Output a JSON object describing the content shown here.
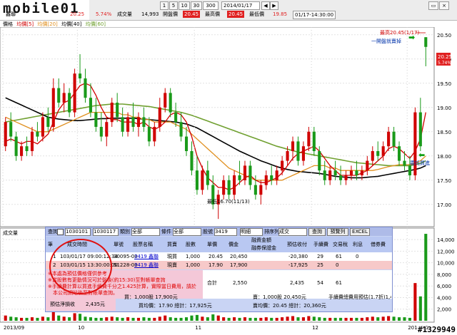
{
  "toolbar": {
    "logo": "mobile01",
    "stock_name": "鑫聯",
    "periods": [
      "1",
      "5",
      "10",
      "30"
    ],
    "period_value": "300",
    "date_value": "2014/01/17",
    "price_value": "20.25",
    "change_pct": "5.74%",
    "labels": {
      "volume": "成交量",
      "open": "開盤價",
      "high": "最高價",
      "low": "最低價"
    },
    "volume_value": "14,993",
    "open_value": "20.45",
    "high_value": "20.45",
    "low_value": "19.85",
    "time_range": "01/17-14:30:00"
  },
  "legend": {
    "price": "價格",
    "ma5": "均價[5]",
    "ma20": "均價[20]",
    "ma40": "均價[40]",
    "ma60": "均價[60]"
  },
  "chart": {
    "high_label": "最高20.45(1/17)",
    "low_label": "最低16.70(11/13)",
    "buy_tag": "一開盤就賣掉",
    "sell_tag": "委託買進",
    "last_price": "20.25",
    "last_pct": "5.74%",
    "volume_title": "成交量",
    "x_ticks": [
      "2013/09",
      "10",
      "11",
      "12",
      "2014/01"
    ],
    "price_ticks": [
      "20.50",
      "20.00",
      "19.50",
      "19.00",
      "18.50",
      "18.00",
      "17.50",
      "17.00"
    ],
    "volume_ticks": [
      "14,000",
      "12,000",
      "10,000",
      "8,000",
      "6,000",
      "4,000",
      "2,000"
    ],
    "watermark": "#1329949"
  },
  "chart_data": {
    "type": "candlestick",
    "title": "",
    "ylim": [
      16.6,
      20.6
    ],
    "ma5_color": "#d00000",
    "ma20_color": "#e09020",
    "ma40_color": "#000000",
    "ma60_color": "#70a030",
    "up_color": "#d00000",
    "down_color": "#1a9a1a",
    "candles": [
      [
        18.2,
        18.8,
        18.1,
        18.7
      ],
      [
        18.7,
        18.9,
        18.3,
        18.4
      ],
      [
        18.4,
        18.5,
        17.9,
        18.0
      ],
      [
        18.0,
        18.3,
        17.9,
        18.2
      ],
      [
        18.2,
        18.4,
        18.0,
        18.1
      ],
      [
        18.1,
        18.6,
        18.0,
        18.5
      ],
      [
        18.5,
        18.7,
        18.3,
        18.4
      ],
      [
        18.4,
        18.9,
        18.3,
        18.8
      ],
      [
        18.8,
        19.0,
        18.5,
        18.6
      ],
      [
        18.6,
        19.6,
        18.5,
        19.4
      ],
      [
        19.4,
        19.6,
        19.0,
        19.1
      ],
      [
        19.1,
        19.5,
        18.9,
        19.3
      ],
      [
        19.3,
        19.4,
        18.8,
        18.9
      ],
      [
        18.9,
        19.8,
        18.8,
        19.7
      ],
      [
        19.7,
        20.1,
        19.5,
        19.6
      ],
      [
        19.6,
        19.8,
        19.1,
        19.2
      ],
      [
        19.2,
        19.5,
        18.8,
        18.9
      ],
      [
        18.9,
        19.2,
        18.5,
        18.6
      ],
      [
        18.6,
        18.9,
        18.3,
        18.4
      ],
      [
        18.4,
        18.8,
        18.2,
        18.7
      ],
      [
        18.7,
        19.2,
        18.6,
        19.1
      ],
      [
        19.1,
        19.3,
        18.7,
        18.8
      ],
      [
        18.8,
        19.0,
        18.4,
        18.5
      ],
      [
        18.5,
        18.9,
        18.4,
        18.8
      ],
      [
        18.8,
        19.1,
        18.5,
        18.6
      ],
      [
        18.6,
        18.9,
        18.4,
        18.8
      ],
      [
        18.8,
        19.0,
        18.5,
        18.6
      ],
      [
        18.6,
        18.8,
        18.2,
        18.3
      ],
      [
        18.3,
        18.7,
        18.2,
        18.6
      ],
      [
        18.6,
        19.2,
        18.5,
        19.0
      ],
      [
        19.0,
        19.4,
        18.9,
        19.3
      ],
      [
        19.3,
        19.4,
        18.8,
        18.9
      ],
      [
        18.9,
        19.1,
        18.6,
        18.7
      ],
      [
        18.7,
        18.9,
        18.3,
        18.4
      ],
      [
        18.4,
        18.6,
        18.0,
        18.1
      ],
      [
        18.1,
        18.3,
        17.6,
        17.7
      ],
      [
        17.7,
        18.0,
        17.2,
        17.3
      ],
      [
        17.3,
        17.8,
        17.2,
        17.7
      ],
      [
        17.7,
        17.9,
        17.3,
        17.4
      ],
      [
        17.4,
        17.6,
        16.9,
        17.0
      ],
      [
        17.0,
        17.3,
        16.7,
        17.2
      ],
      [
        17.2,
        17.6,
        17.1,
        17.5
      ],
      [
        17.5,
        17.6,
        17.1,
        17.2
      ],
      [
        17.2,
        17.7,
        17.1,
        17.6
      ],
      [
        17.6,
        17.9,
        17.4,
        17.5
      ],
      [
        17.5,
        17.9,
        17.4,
        17.8
      ],
      [
        17.8,
        17.9,
        17.3,
        17.4
      ],
      [
        17.4,
        17.6,
        17.1,
        17.2
      ],
      [
        17.2,
        17.5,
        17.0,
        17.4
      ],
      [
        17.4,
        17.7,
        17.3,
        17.6
      ],
      [
        17.6,
        17.8,
        17.4,
        17.5
      ],
      [
        17.5,
        17.8,
        17.4,
        17.7
      ],
      [
        17.7,
        18.0,
        17.6,
        17.9
      ],
      [
        17.9,
        18.2,
        17.8,
        18.1
      ],
      [
        18.1,
        18.4,
        17.9,
        18.3
      ],
      [
        18.3,
        18.4,
        17.8,
        17.9
      ],
      [
        17.9,
        18.3,
        17.8,
        18.2
      ],
      [
        18.2,
        18.6,
        18.1,
        18.5
      ],
      [
        18.5,
        18.6,
        18.0,
        18.1
      ],
      [
        18.1,
        18.2,
        17.6,
        17.7
      ],
      [
        17.7,
        17.9,
        17.4,
        17.5
      ],
      [
        17.5,
        17.8,
        17.4,
        17.7
      ],
      [
        17.7,
        17.9,
        17.5,
        17.6
      ],
      [
        17.6,
        17.8,
        17.4,
        17.5
      ],
      [
        17.5,
        17.7,
        17.4,
        17.6
      ],
      [
        17.6,
        17.8,
        17.5,
        17.7
      ],
      [
        17.7,
        17.9,
        17.5,
        17.6
      ],
      [
        17.6,
        17.8,
        17.5,
        17.7
      ],
      [
        17.7,
        18.0,
        17.6,
        17.9
      ],
      [
        17.9,
        18.2,
        17.8,
        18.1
      ],
      [
        18.1,
        18.3,
        17.9,
        18.0
      ],
      [
        18.0,
        18.3,
        17.9,
        18.2
      ],
      [
        18.2,
        18.6,
        18.1,
        18.5
      ],
      [
        18.5,
        18.6,
        18.1,
        18.2
      ],
      [
        18.2,
        18.3,
        17.8,
        17.9
      ],
      [
        17.9,
        18.1,
        17.7,
        17.8
      ],
      [
        17.8,
        18.0,
        17.5,
        17.6
      ],
      [
        17.6,
        19.0,
        17.5,
        18.9
      ],
      [
        18.9,
        19.2,
        18.1,
        18.2
      ],
      [
        20.45,
        20.45,
        19.85,
        20.25
      ]
    ],
    "ma5": [
      18.3,
      18.35,
      18.3,
      18.25,
      18.3,
      18.3,
      18.25,
      18.35,
      18.45,
      18.7,
      18.95,
      19.1,
      19.15,
      19.3,
      19.45,
      19.5,
      19.45,
      19.25,
      19.0,
      18.8,
      18.75,
      18.75,
      18.7,
      18.7,
      18.7,
      18.65,
      18.7,
      18.6,
      18.55,
      18.6,
      18.7,
      18.85,
      18.9,
      18.85,
      18.7,
      18.4,
      18.0,
      17.75,
      17.55,
      17.45,
      17.35,
      17.35,
      17.3,
      17.35,
      17.45,
      17.55,
      17.6,
      17.5,
      17.45,
      17.45,
      17.5,
      17.55,
      17.65,
      17.8,
      17.95,
      18.05,
      18.1,
      18.15,
      18.2,
      18.1,
      17.95,
      17.8,
      17.7,
      17.6,
      17.6,
      17.6,
      17.6,
      17.65,
      17.7,
      17.8,
      17.9,
      18.0,
      18.15,
      18.2,
      18.15,
      18.05,
      17.95,
      18.1,
      18.35,
      18.9
    ],
    "ma20": [
      18.8,
      18.75,
      18.7,
      18.65,
      18.6,
      18.55,
      18.5,
      18.5,
      18.5,
      18.55,
      18.6,
      18.65,
      18.7,
      18.75,
      18.8,
      18.85,
      18.9,
      18.9,
      18.9,
      18.9,
      18.9,
      18.9,
      18.85,
      18.85,
      18.8,
      18.8,
      18.75,
      18.75,
      18.7,
      18.7,
      18.7,
      18.7,
      18.65,
      18.6,
      18.55,
      18.45,
      18.35,
      18.25,
      18.15,
      18.05,
      17.95,
      17.85,
      17.75,
      17.7,
      17.65,
      17.6,
      17.55,
      17.5,
      17.5,
      17.5,
      17.5,
      17.5,
      17.5,
      17.55,
      17.6,
      17.65,
      17.7,
      17.75,
      17.8,
      17.8,
      17.8,
      17.75,
      17.75,
      17.7,
      17.7,
      17.7,
      17.7,
      17.7,
      17.7,
      17.7,
      17.72,
      17.75,
      17.78,
      17.8,
      17.82,
      17.82,
      17.82,
      17.85,
      17.9,
      18.0
    ],
    "ma40": [
      19.2,
      19.15,
      19.1,
      19.05,
      19.0,
      18.95,
      18.9,
      18.85,
      18.8,
      18.78,
      18.76,
      18.75,
      18.74,
      18.73,
      18.73,
      18.74,
      18.75,
      18.76,
      18.77,
      18.77,
      18.78,
      18.78,
      18.78,
      18.78,
      18.78,
      18.77,
      18.76,
      18.75,
      18.74,
      18.73,
      18.72,
      18.71,
      18.7,
      18.68,
      18.66,
      18.62,
      18.58,
      18.52,
      18.46,
      18.4,
      18.34,
      18.28,
      18.22,
      18.16,
      18.1,
      18.05,
      18.0,
      17.95,
      17.9,
      17.86,
      17.82,
      17.78,
      17.75,
      17.72,
      17.7,
      17.68,
      17.67,
      17.66,
      17.65,
      17.64,
      17.62,
      17.6,
      17.58,
      17.57,
      17.56,
      17.55,
      17.55,
      17.55,
      17.56,
      17.57,
      17.58,
      17.6,
      17.62,
      17.64,
      17.66,
      17.68,
      17.7,
      17.72,
      17.75,
      17.8
    ],
    "ma60": [
      18.7,
      18.72,
      18.74,
      18.76,
      18.78,
      18.8,
      18.82,
      18.84,
      18.86,
      18.88,
      18.9,
      18.92,
      18.94,
      18.96,
      18.98,
      19.0,
      19.02,
      19.04,
      19.05,
      19.06,
      19.07,
      19.07,
      19.07,
      19.06,
      19.05,
      19.04,
      19.03,
      19.02,
      19.0,
      18.98,
      18.96,
      18.94,
      18.92,
      18.9,
      18.87,
      18.84,
      18.8,
      18.76,
      18.72,
      18.68,
      18.64,
      18.6,
      18.56,
      18.52,
      18.48,
      18.44,
      18.4,
      18.36,
      18.32,
      18.28,
      18.24,
      18.2,
      18.17,
      18.14,
      18.11,
      18.08,
      18.06,
      18.04,
      18.02,
      18.0,
      17.98,
      17.96,
      17.94,
      17.92,
      17.9,
      17.88,
      17.86,
      17.85,
      17.84,
      17.83,
      17.82,
      17.81,
      17.8,
      17.8,
      17.8,
      17.8,
      17.8,
      17.82,
      17.85,
      17.9
    ],
    "volume": [
      900,
      700,
      600,
      500,
      500,
      600,
      500,
      700,
      600,
      1500,
      900,
      700,
      600,
      1300,
      1200,
      700,
      600,
      500,
      500,
      600,
      700,
      600,
      500,
      600,
      500,
      500,
      600,
      500,
      500,
      700,
      900,
      600,
      500,
      500,
      600,
      900,
      1000,
      700,
      600,
      1100,
      900,
      600,
      500,
      600,
      500,
      600,
      500,
      500,
      500,
      600,
      500,
      500,
      600,
      700,
      800,
      600,
      600,
      800,
      700,
      600,
      500,
      500,
      500,
      500,
      500,
      500,
      500,
      500,
      600,
      700,
      600,
      700,
      800,
      700,
      600,
      600,
      500,
      6500,
      4200,
      14993
    ],
    "vlim": [
      0,
      15000
    ]
  },
  "panel": {
    "toolbar": {
      "query_label": "查詢",
      "date_from": "1030101",
      "date_to": "1030117",
      "cat_label": "類別",
      "cat_value": "全部",
      "kind_label": "條件",
      "kind_value": "全部",
      "code_label": "股號",
      "code_value": "3419",
      "detail_value": "明細",
      "sort_label": "排序列",
      "sort_value": "成交",
      "query_btn": "查詢",
      "preview_btn": "預覽列",
      "excel_btn": "EXCEL"
    },
    "headers": [
      "筆",
      "成交時間",
      "單號",
      "股票名稱",
      "買賣",
      "股數",
      "單價",
      "價金",
      "融資金額\n融券保證金",
      "預估收付",
      "手續費",
      "交易稅",
      "利息",
      "借券費"
    ],
    "rows": [
      [
        "1",
        "103/01/17 09:00:12:34",
        "30095-00",
        "3419 鑫聯",
        "現買",
        "1,000",
        "20.45",
        "20,450",
        "",
        "-20,380",
        "29",
        "61",
        "0",
        ""
      ],
      [
        "2",
        "103/01/15 13:30:00:00",
        "51228-00",
        "3419 鑫聯",
        "現賣",
        "1,000",
        "17.90",
        "17,900",
        "",
        "-17,925",
        "25",
        "0",
        "",
        ""
      ]
    ],
    "notes": [
      "※本處為預估價格僅供參考",
      "※當股數有更動情況可於盤後(約15:30)至對帳單查詢",
      "※手續費計算以買進手續費千分之1.425計算，實際當日費用，請於",
      "　本公司網站後至對帳單查詢。"
    ],
    "summary": {
      "total_label": "合計",
      "total_amount": "2,550",
      "total_recv": "2,435",
      "total_fee": "54",
      "total_tax": "61",
      "profit_label": "預估淨損收",
      "profit_value": "2,435元",
      "buy_line": "買：1,000股  17,900元",
      "sell_line": "賣：1,000股  20,450元",
      "fee_line": "手續費總費用預估(1.7折)1,44元",
      "avg_buy": "買均價：17.90  總計：17,925元",
      "avg_sell": "賣均價：20.45  總計：20,360元"
    }
  }
}
